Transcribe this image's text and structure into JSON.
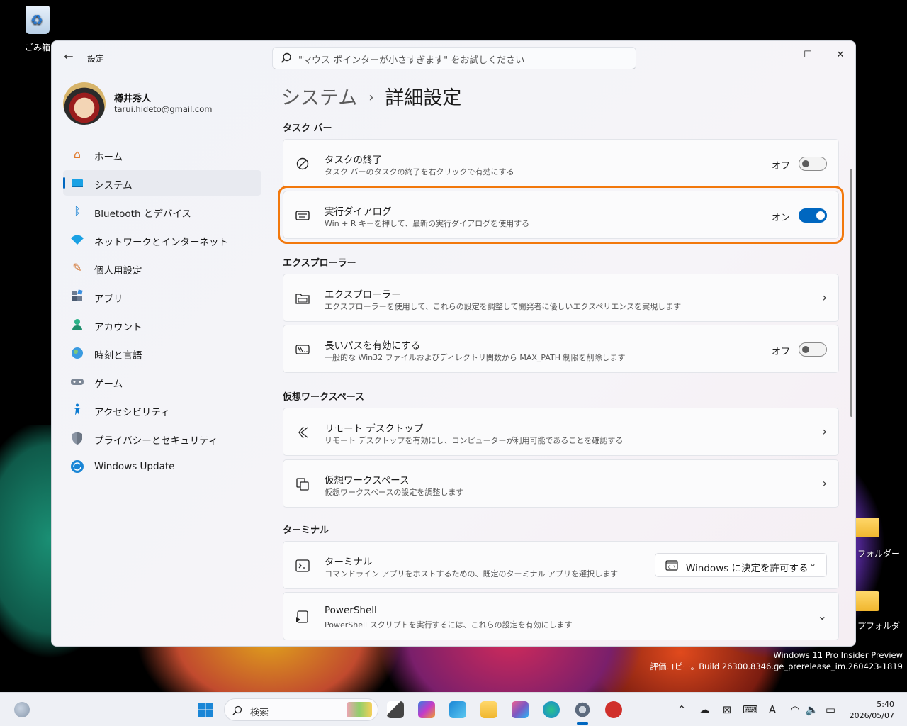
{
  "desktop": {
    "recycle_bin_label": "ごみ箱",
    "folder1_label": "フォルダー",
    "folder2_label": "プフォルダ",
    "watermark_line1": "Windows 11 Pro Insider Preview",
    "watermark_line2": "評価コピー。Build 26300.8346.ge_prerelease_im.260423-1819"
  },
  "window": {
    "app_title": "設定",
    "search_placeholder": "\"マウス ポインターが小さすぎます\" をお試しください",
    "controls": {
      "minimize": "—",
      "maximize": "☐",
      "close": "✕"
    }
  },
  "profile": {
    "name": "樽井秀人",
    "email": "tarui.hideto@gmail.com"
  },
  "nav": [
    {
      "label": "ホーム",
      "icon": "home-icon"
    },
    {
      "label": "システム",
      "icon": "system-icon",
      "active": true
    },
    {
      "label": "Bluetooth とデバイス",
      "icon": "bluetooth-icon"
    },
    {
      "label": "ネットワークとインターネット",
      "icon": "wifi-icon"
    },
    {
      "label": "個人用設定",
      "icon": "brush-icon"
    },
    {
      "label": "アプリ",
      "icon": "apps-icon"
    },
    {
      "label": "アカウント",
      "icon": "account-icon"
    },
    {
      "label": "時刻と言語",
      "icon": "time-language-icon"
    },
    {
      "label": "ゲーム",
      "icon": "gaming-icon"
    },
    {
      "label": "アクセシビリティ",
      "icon": "accessibility-icon"
    },
    {
      "label": "プライバシーとセキュリティ",
      "icon": "shield-icon"
    },
    {
      "label": "Windows Update",
      "icon": "update-icon"
    }
  ],
  "breadcrumb": {
    "parent": "システム",
    "separator": "›",
    "current": "詳細設定"
  },
  "sections": {
    "taskbar": "タスク バー",
    "explorer": "エクスプローラー",
    "virtual_workspace": "仮想ワークスペース",
    "terminal": "ターミナル"
  },
  "cards": {
    "end_task": {
      "title": "タスクの終了",
      "desc": "タスク バーのタスクの終了を右クリックで有効にする",
      "state": "オフ",
      "on": false
    },
    "run_dialog": {
      "title": "実行ダイアログ",
      "desc": "Win + R キーを押して、最新の実行ダイアログを使用する",
      "state": "オン",
      "on": true
    },
    "explorer": {
      "title": "エクスプローラー",
      "desc": "エクスプローラーを使用して、これらの設定を調整して開発者に優しいエクスペリエンスを実現します"
    },
    "long_paths": {
      "title": "長いパスを有効にする",
      "desc": "一般的な Win32 ファイルおよびディレクトリ関数から MAX_PATH 制限を削除します",
      "state": "オフ",
      "on": false
    },
    "remote_desktop": {
      "title": "リモート デスクトップ",
      "desc": "リモート デスクトップを有効にし、コンピューターが利用可能であることを確認する"
    },
    "virtual_workspace": {
      "title": "仮想ワークスペース",
      "desc": "仮想ワークスペースの設定を調整します"
    },
    "terminal": {
      "title": "ターミナル",
      "desc": "コマンドライン アプリをホストするための、既定のターミナル アプリを選択します",
      "dropdown_value": "Windows に決定を許可する"
    },
    "powershell": {
      "title": "PowerShell",
      "desc": "PowerShell スクリプトを実行するには、これらの設定を有効にします"
    }
  },
  "taskbar": {
    "search_label": "検索",
    "time": "5:40",
    "date": "2026/05/07",
    "ime": "A"
  },
  "colors": {
    "accent": "#0067c0",
    "highlight": "#f2780c"
  }
}
